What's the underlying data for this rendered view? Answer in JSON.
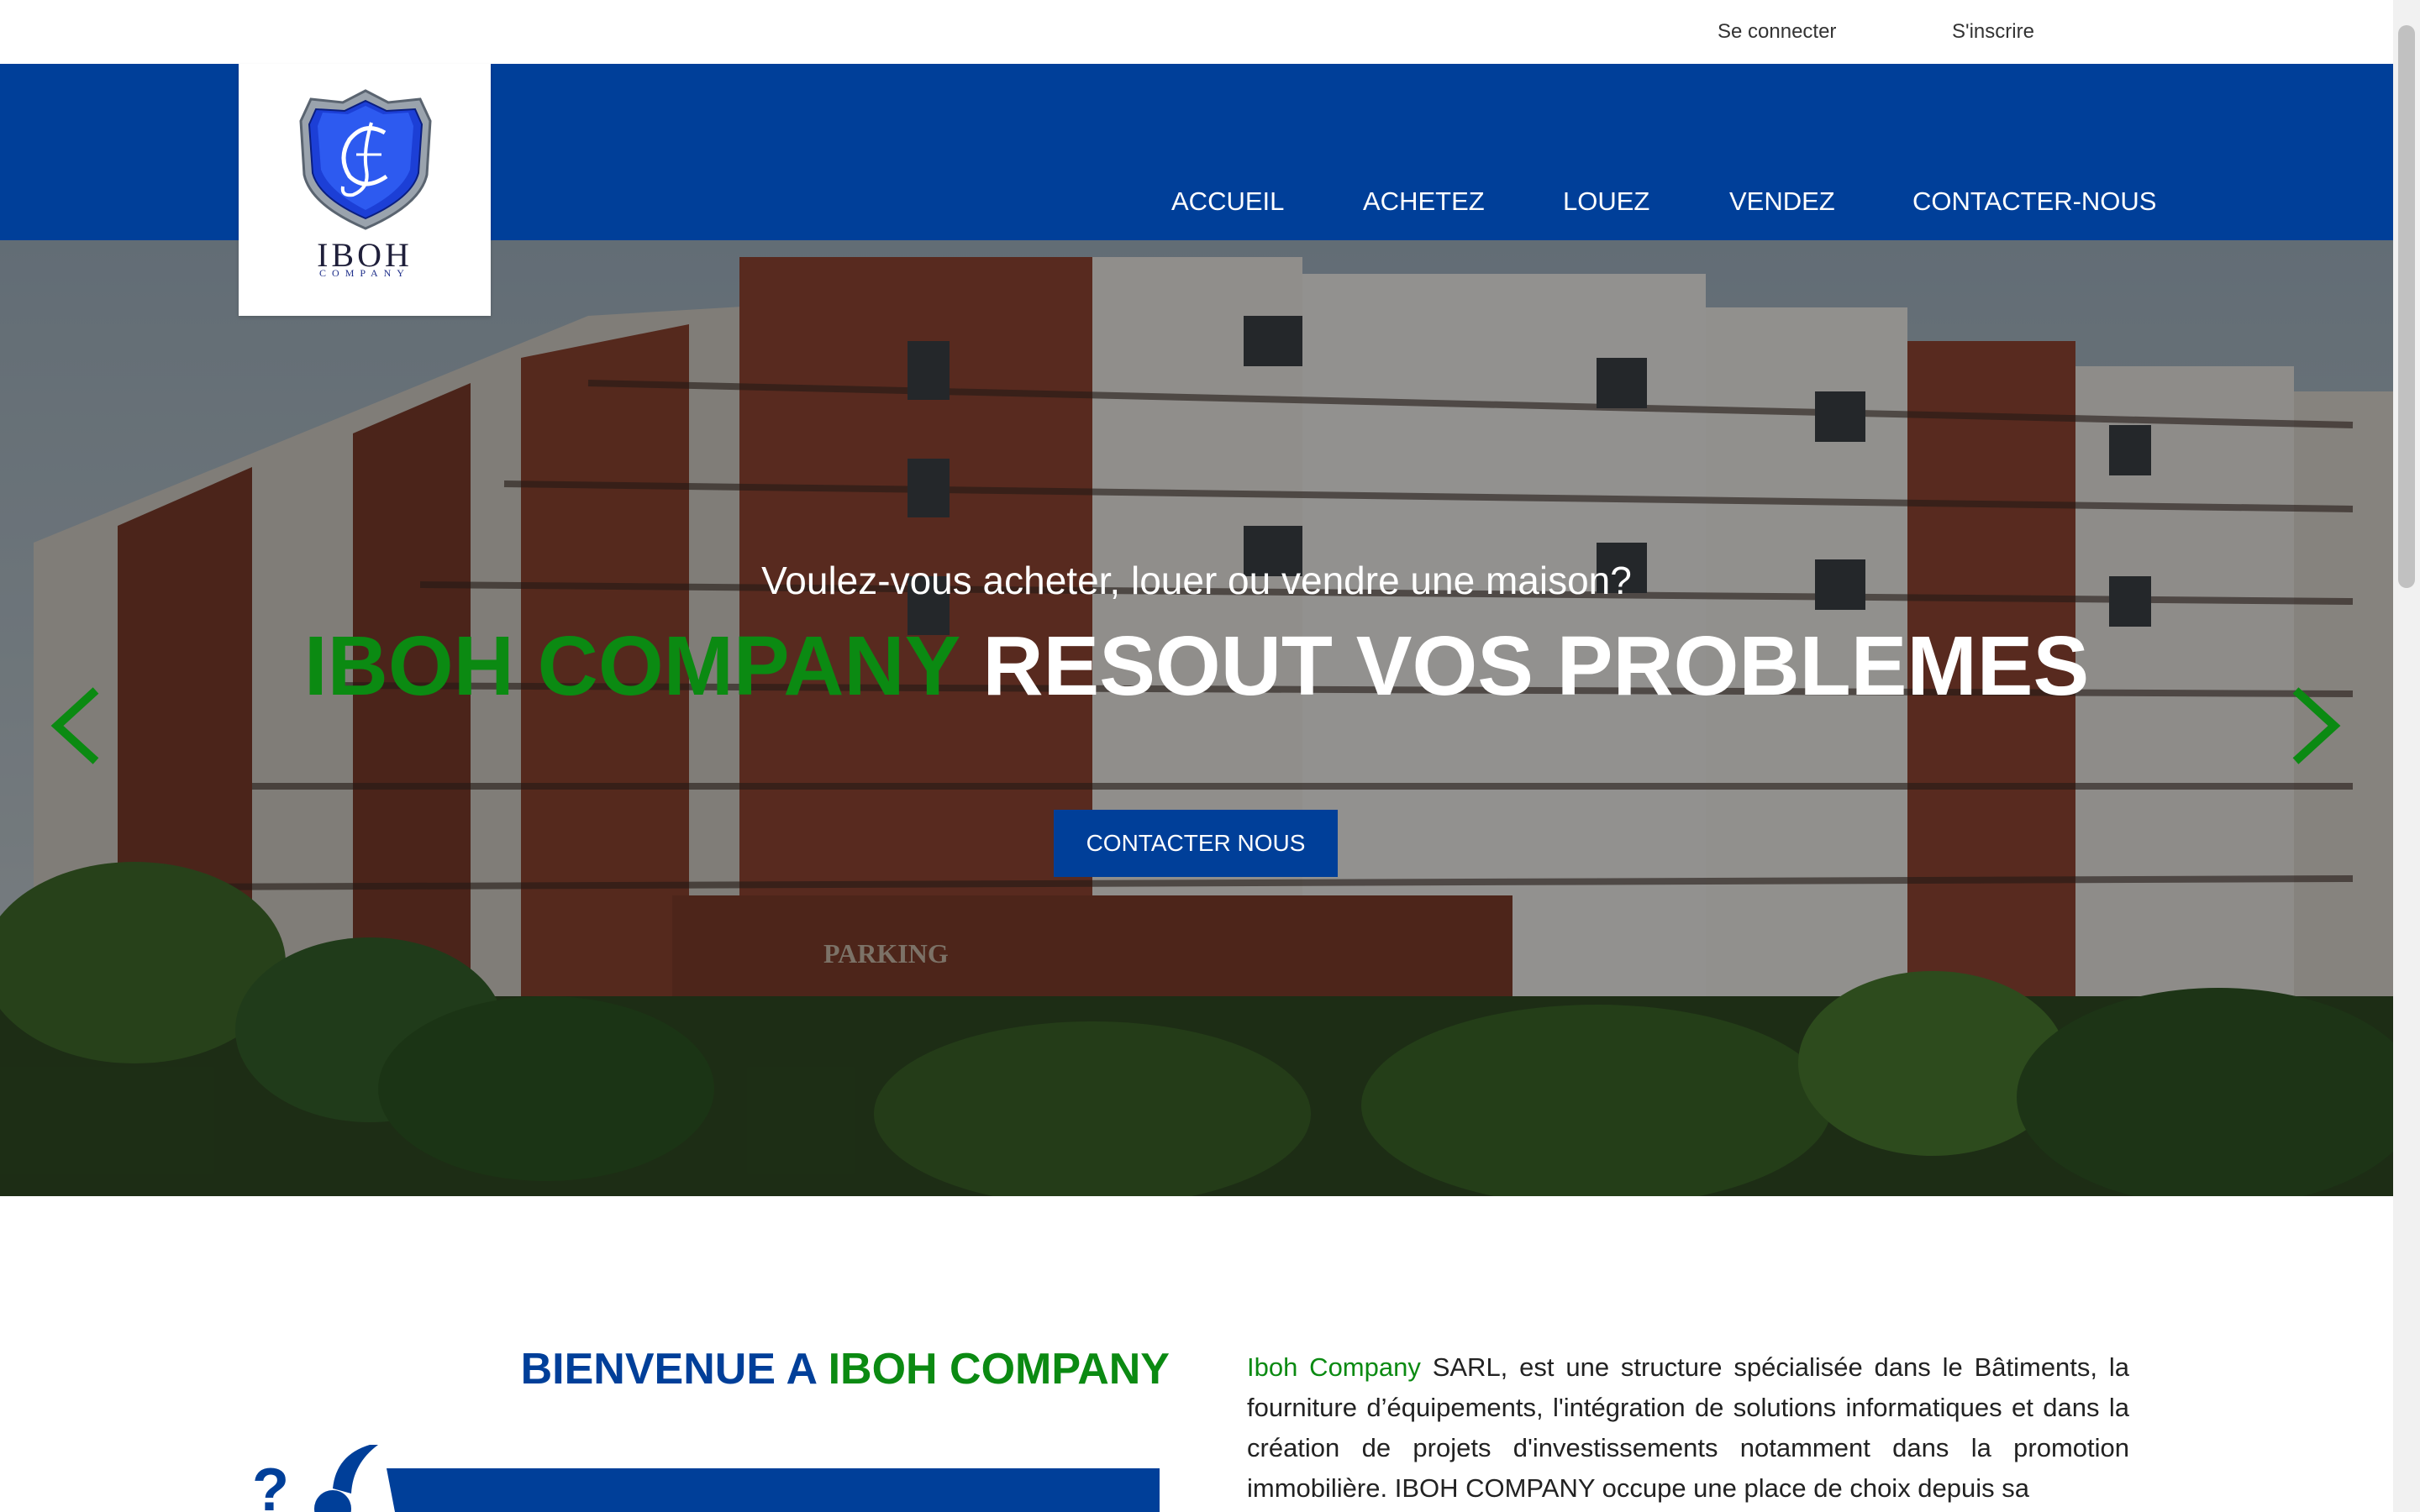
{
  "auth": {
    "login": "Se connecter",
    "signup": "S'inscrire"
  },
  "logo": {
    "name": "IBOH",
    "sub": "COMPANY"
  },
  "nav": [
    "ACCUEIL",
    "ACHETEZ",
    "LOUEZ",
    "VENDEZ",
    "CONTACTER-NOUS"
  ],
  "hero": {
    "question": "Voulez-vous acheter, louer ou vendre une maison?",
    "brand": "IBOH COMPANY",
    "tagline": "RESOUT VOS PROBLEMES",
    "button": "CONTACTER NOUS",
    "sign": "PARKING"
  },
  "intro": {
    "title_prefix": "BIENVENUE A ",
    "title_brand": "IBOH COMPANY",
    "text_brand": "Iboh Company",
    "text": " SARL, est une structure spécialisée dans le Bâtiments, la fourniture d’équipements, l'intégration de solutions informatiques et dans la création de projets d'investissements notamment dans la promotion immobilière. IBOH COMPANY occupe une place de choix depuis sa"
  },
  "colors": {
    "primary": "#003f99",
    "accent": "#0b8a12"
  }
}
